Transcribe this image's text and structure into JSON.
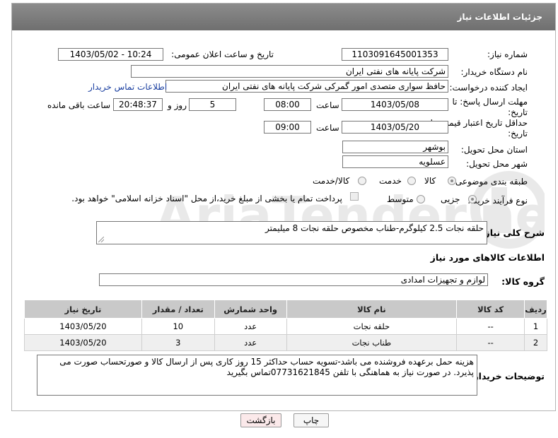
{
  "header": {
    "title": "جزئیات اطلاعات نیاز"
  },
  "fields": {
    "need_number_label": "شماره نیاز:",
    "need_number": "1103091645001353",
    "announce_label": "تاریخ و ساعت اعلان عمومی:",
    "announce_value": "1403/05/02 - 10:24",
    "buyer_label": "نام دستگاه خریدار:",
    "buyer_value": "شرکت پایانه های نفتی ایران",
    "creator_label": "ایجاد کننده درخواست:",
    "creator_value": "حافظ سواری متصدی امور گمرکی شرکت پایانه های نفتی ایران",
    "contact_link": "اطلاعات تماس خریدار",
    "deadline_label": "مهلت ارسال پاسخ: تا تاریخ:",
    "deadline_date": "1403/05/08",
    "time_label": "ساعت",
    "deadline_time": "08:00",
    "days_value": "5",
    "days_label": "روز و",
    "remaining_time": "20:48:37",
    "remaining_label": "ساعت باقی مانده",
    "validity_label": "حداقل تاریخ اعتبار قیمت: تا تاریخ:",
    "validity_date": "1403/05/20",
    "validity_time_label": "ساعت",
    "validity_time": "09:00",
    "province_label": "استان محل تحویل:",
    "province_value": "بوشهر",
    "city_label": "شهر محل تحویل:",
    "city_value": "عسلویه",
    "category_label": "طبقه بندی موضوعی:",
    "category_options": [
      "کالا",
      "خدمت",
      "کالا/خدمت"
    ],
    "category_selected": "کالا",
    "process_label": "نوع فرآیند خرید :",
    "process_options": [
      "جزیی",
      "متوسط"
    ],
    "process_selected": "جزیی",
    "payment_note": "پرداخت تمام یا بخشی از مبلغ خرید،از محل \"اسناد خزانه اسلامی\" خواهد بود."
  },
  "summary": {
    "label": "شرح کلی نیاز:",
    "value": "حلقه نجات 2.5 کیلوگرم-طناب مخصوص حلقه نجات 8 میلیمتر"
  },
  "goods_section": {
    "title": "اطلاعات کالاهای مورد نیاز",
    "group_label": "گروه کالا:",
    "group_value": "لوازم و تجهیزات امدادی"
  },
  "table": {
    "headers": [
      "ردیف",
      "کد کالا",
      "نام کالا",
      "واحد شمارش",
      "تعداد / مقدار",
      "تاریخ نیاز"
    ],
    "rows": [
      [
        "1",
        "--",
        "حلقه نجات",
        "عدد",
        "10",
        "1403/05/20"
      ],
      [
        "2",
        "--",
        "طناب نجات",
        "عدد",
        "3",
        "1403/05/20"
      ]
    ]
  },
  "buyer_notes": {
    "label": "توضیحات خریدار:",
    "text": "هزینه حمل برعهده فروشنده می باشد-تسویه حساب حداکثر 15 روز کاری پس از ارسال کالا و صورتحساب صورت می پذیرد. در صورت نیاز به هماهنگی با تلفن 07731621845تماس بگیرید"
  },
  "buttons": {
    "print": "چاپ",
    "back": "بازگشت"
  },
  "colors": {
    "header_bg": "#7d7d7d",
    "link": "#1a3fa0",
    "back_btn_bg": "#fbe9ea"
  }
}
